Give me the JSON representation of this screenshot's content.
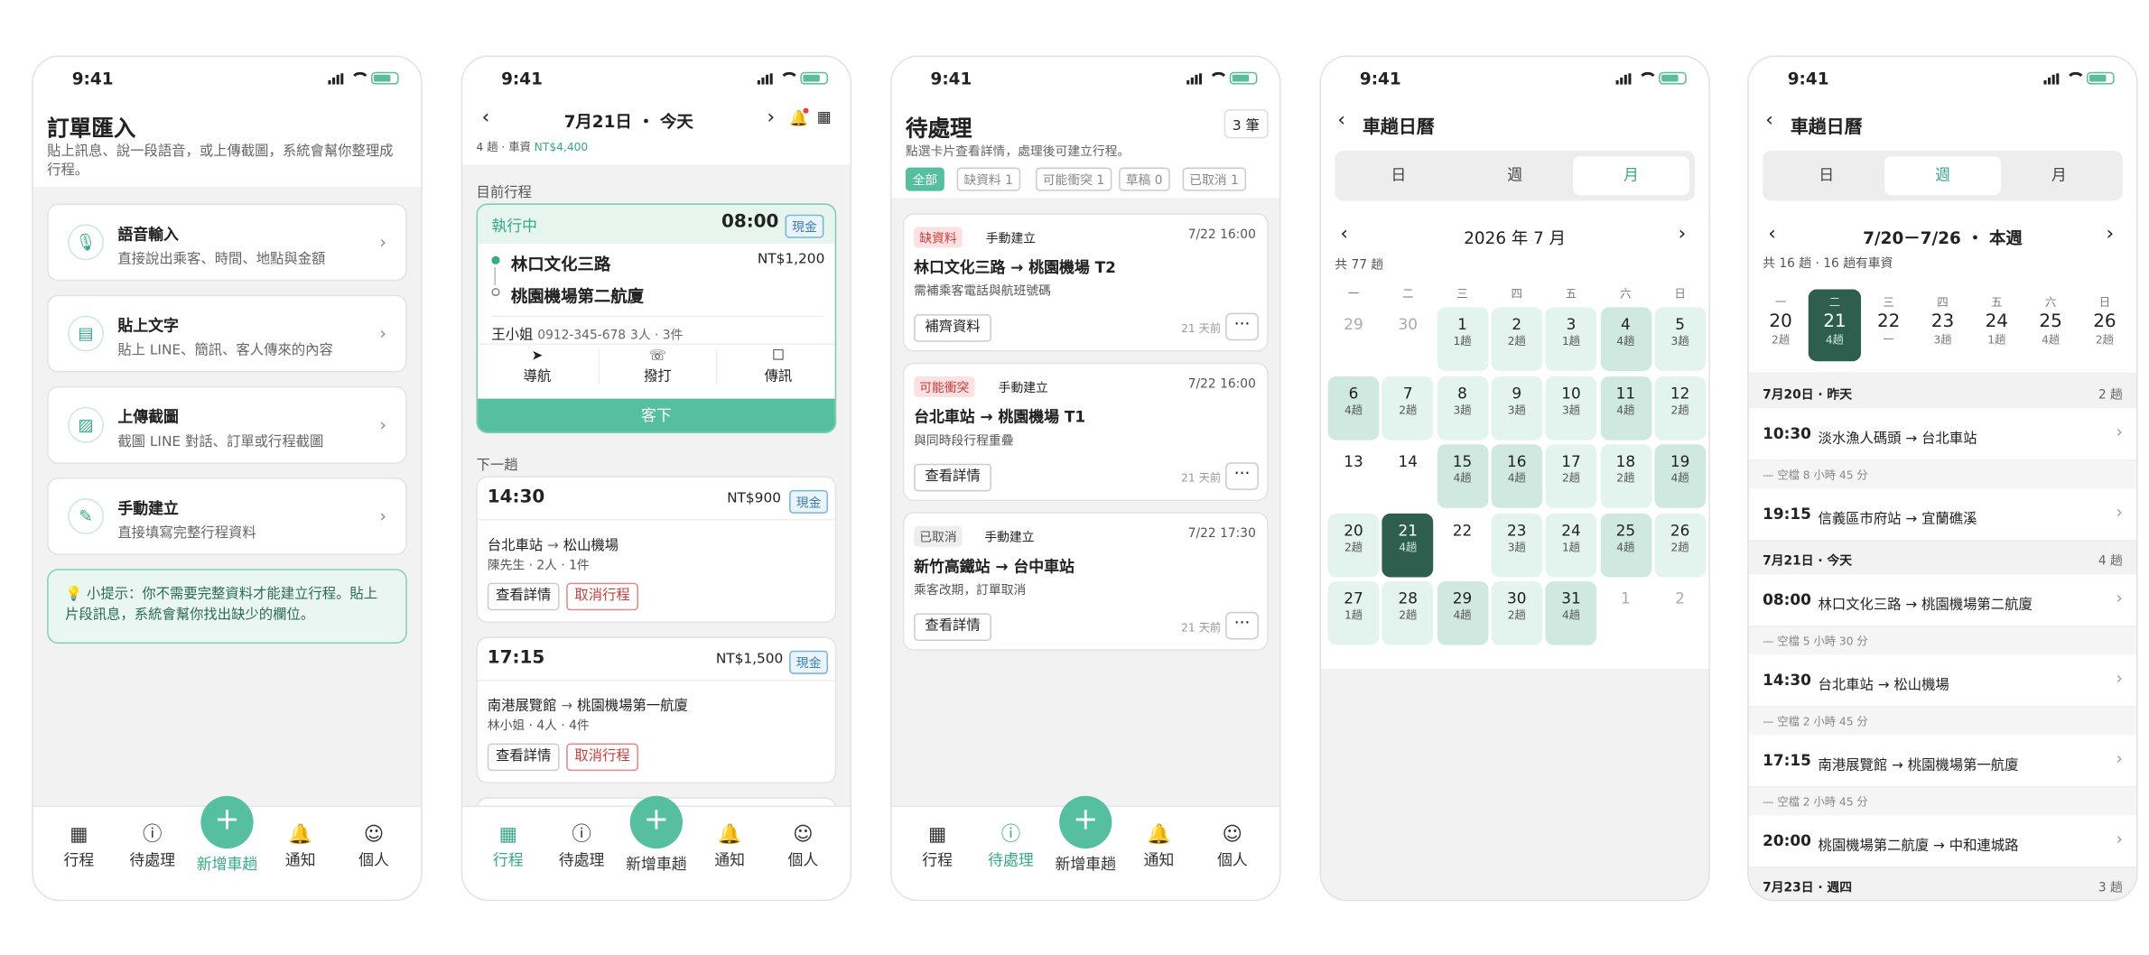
{
  "status_time": "9:41",
  "colors": {
    "accent": "#55bfa0",
    "accent_dark": "#2e5e4e",
    "warn_red": "#cc3b3b"
  },
  "p1": {
    "title": "訂單匯入",
    "subtitle": "貼上訊息、說一段語音，或上傳截圖，系統會幫你整理成行程。",
    "options": [
      {
        "icon": "mic-icon",
        "title": "語音輸入",
        "desc": "直接說出乘客、時間、地點與金額"
      },
      {
        "icon": "document-icon",
        "title": "貼上文字",
        "desc": "貼上 LINE、簡訊、客人傳來的內容"
      },
      {
        "icon": "image-icon",
        "title": "上傳截圖",
        "desc": "截圖 LINE 對話、訂單或行程截圖"
      },
      {
        "icon": "pencil-icon",
        "title": "手動建立",
        "desc": "直接填寫完整行程資料"
      }
    ],
    "tip": "💡 小提示：你不需要完整資料才能建立行程。貼上片段訊息，系統會幫你找出缺少的欄位。"
  },
  "tabbar": {
    "trips": "行程",
    "pending": "待處理",
    "add": "新增車趟",
    "notify": "通知",
    "profile": "個人"
  },
  "p2": {
    "date_title": "7月21日 ・ 今天",
    "summary_count": "4 趟 · 車資",
    "summary_amount": "NT$4,400",
    "current_label": "目前行程",
    "current": {
      "status": "執行中",
      "time": "08:00",
      "pay": "現金",
      "from": "林口文化三路",
      "to": "桃園機場第二航廈",
      "fare": "NT$1,200",
      "passenger": "王小姐",
      "phone": "0912-345-678",
      "pax": "3人 · 3件",
      "actions": [
        "導航",
        "撥打",
        "傳訊"
      ],
      "dropoff": "客下"
    },
    "next_label": "下一趟",
    "upcoming": [
      {
        "time": "14:30",
        "fare": "NT$900",
        "pay": "現金",
        "route_from": "台北車站",
        "route_to": "松山機場",
        "who": "陳先生",
        "pax": "2人 · 1件",
        "detail": "查看詳情",
        "cancel": "取消行程"
      },
      {
        "time": "17:15",
        "fare": "NT$1,500",
        "pay": "現金",
        "route_from": "南港展覽館",
        "route_to": "桃園機場第一航廈",
        "who": "林小姐",
        "pax": "4人 · 4件",
        "detail": "查看詳情",
        "cancel": "取消行程"
      }
    ]
  },
  "p3": {
    "title": "待處理",
    "count": "3 筆",
    "subtitle": "點選卡片查看詳情，處理後可建立行程。",
    "filters": [
      "全部",
      "缺資料 1",
      "可能衝突 1",
      "草稿 0",
      "已取消 1"
    ],
    "items": [
      {
        "tag": "缺資料",
        "source": "手動建立",
        "when": "7/22 16:00",
        "from": "林口文化三路",
        "to": "桃園機場 T2",
        "note": "需補乘客電話與航班號碼",
        "action": "補齊資料",
        "ago": "21 天前"
      },
      {
        "tag": "可能衝突",
        "source": "手動建立",
        "when": "7/22 16:00",
        "from": "台北車站",
        "to": "桃園機場 T1",
        "note": "與同時段行程重疊",
        "action": "查看詳情",
        "ago": "21 天前"
      },
      {
        "tag": "已取消",
        "source": "手動建立",
        "when": "7/22 17:30",
        "from": "新竹高鐵站",
        "to": "台中車站",
        "note": "乘客改期，訂單取消",
        "action": "查看詳情",
        "ago": "21 天前"
      }
    ]
  },
  "p4": {
    "title": "車趟日曆",
    "seg": [
      "日",
      "週",
      "月"
    ],
    "month": "2026 年 7 月",
    "total": "共 77 趟",
    "weekdays": [
      "一",
      "二",
      "三",
      "四",
      "五",
      "六",
      "日"
    ],
    "cells": [
      {
        "d": "29",
        "t": ""
      },
      {
        "d": "30",
        "t": ""
      },
      {
        "d": "1",
        "t": "1趟"
      },
      {
        "d": "2",
        "t": "2趟"
      },
      {
        "d": "3",
        "t": "1趟"
      },
      {
        "d": "4",
        "t": "4趟"
      },
      {
        "d": "5",
        "t": "3趟"
      },
      {
        "d": "6",
        "t": "4趟"
      },
      {
        "d": "7",
        "t": "2趟"
      },
      {
        "d": "8",
        "t": "3趟"
      },
      {
        "d": "9",
        "t": "3趟"
      },
      {
        "d": "10",
        "t": "3趟"
      },
      {
        "d": "11",
        "t": "4趟"
      },
      {
        "d": "12",
        "t": "2趟"
      },
      {
        "d": "13",
        "t": ""
      },
      {
        "d": "14",
        "t": ""
      },
      {
        "d": "15",
        "t": "4趟"
      },
      {
        "d": "16",
        "t": "4趟"
      },
      {
        "d": "17",
        "t": "2趟"
      },
      {
        "d": "18",
        "t": "2趟"
      },
      {
        "d": "19",
        "t": "4趟"
      },
      {
        "d": "20",
        "t": "2趟"
      },
      {
        "d": "21",
        "t": "4趟"
      },
      {
        "d": "22",
        "t": ""
      },
      {
        "d": "23",
        "t": "3趟"
      },
      {
        "d": "24",
        "t": "1趟"
      },
      {
        "d": "25",
        "t": "4趟"
      },
      {
        "d": "26",
        "t": "2趟"
      },
      {
        "d": "27",
        "t": "1趟"
      },
      {
        "d": "28",
        "t": "2趟"
      },
      {
        "d": "29",
        "t": "4趟"
      },
      {
        "d": "30",
        "t": "2趟"
      },
      {
        "d": "31",
        "t": "4趟"
      },
      {
        "d": "1",
        "t": ""
      },
      {
        "d": "2",
        "t": ""
      }
    ]
  },
  "p5": {
    "title": "車趟日曆",
    "seg": [
      "日",
      "週",
      "月"
    ],
    "week_title": "7/20－7/26 ・ 本週",
    "summary": "共 16 趟 · 16 趟有車資",
    "days": [
      {
        "w": "一",
        "d": "20",
        "t": "2趟"
      },
      {
        "w": "二",
        "d": "21",
        "t": "4趟"
      },
      {
        "w": "三",
        "d": "22",
        "t": "—"
      },
      {
        "w": "四",
        "d": "23",
        "t": "3趟"
      },
      {
        "w": "五",
        "d": "24",
        "t": "1趟"
      },
      {
        "w": "六",
        "d": "25",
        "t": "4趟"
      },
      {
        "w": "日",
        "d": "26",
        "t": "2趟"
      }
    ],
    "sections": [
      {
        "label": "7月20日 · 昨天",
        "count": "2 趟"
      },
      {
        "label": "7月21日 · 今天",
        "count": "4 趟"
      },
      {
        "label": "7月23日 · 週四",
        "count": "3 趟"
      }
    ],
    "rows": [
      {
        "time": "10:30",
        "route": "淡水漁人碼頭 → 台北車站"
      },
      {
        "gap": "空檔 8 小時 45 分"
      },
      {
        "time": "19:15",
        "route": "信義區市府站 → 宜蘭礁溪"
      },
      {
        "time": "08:00",
        "route": "林口文化三路 → 桃園機場第二航廈"
      },
      {
        "gap": "空檔 5 小時 30 分"
      },
      {
        "time": "14:30",
        "route": "台北車站 → 松山機場"
      },
      {
        "gap": "空檔 2 小時 45 分"
      },
      {
        "time": "17:15",
        "route": "南港展覽館 → 桃園機場第一航廈"
      },
      {
        "gap": "空檔 2 小時 45 分"
      },
      {
        "time": "20:00",
        "route": "桃園機場第二航廈 → 中和連城路"
      }
    ]
  }
}
